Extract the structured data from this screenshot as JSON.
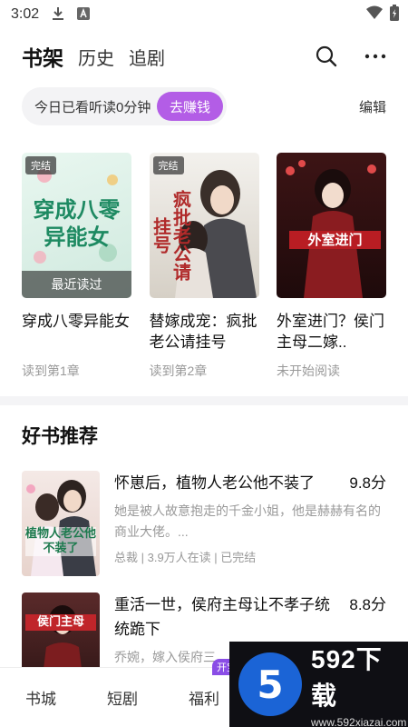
{
  "status_bar": {
    "time": "3:02",
    "icons": [
      "download-icon",
      "a-app-icon",
      "wifi-icon",
      "battery-icon"
    ]
  },
  "header": {
    "tabs": [
      {
        "label": "书架",
        "active": true
      },
      {
        "label": "历史",
        "active": false
      },
      {
        "label": "追剧",
        "active": false
      }
    ],
    "icons": [
      "search-icon",
      "more-icon"
    ]
  },
  "read_bar": {
    "text": "今日已看听读0分钟",
    "button": "去赚钱"
  },
  "edit_label": "编辑",
  "shelf": [
    {
      "title": "穿成八零异能女",
      "progress": "读到第1章",
      "badge": "完结",
      "last_read": "最近读过",
      "cover_text": "穿成八零异能女",
      "colors": [
        "#dff2ec",
        "#eaf6ef"
      ]
    },
    {
      "title": "替嫁成宠：疯批老公请挂号",
      "progress": "读到第2章",
      "badge": "完结",
      "cover_text": "疯批老公请挂号",
      "colors": [
        "#f0eeea",
        "#d9d4cc"
      ]
    },
    {
      "title": "外室进门？侯门主母二嫁..",
      "progress": "未开始阅读",
      "cover_text": "外室进门",
      "colors": [
        "#5a1d1d",
        "#2a0f10"
      ]
    }
  ],
  "section_title": "好书推荐",
  "recommendations": [
    {
      "title": "怀崽后，植物人老公他不装了",
      "score": "9.8分",
      "desc": "她是被人故意抱走的千金小姐，他是赫赫有名的商业大佬。...",
      "meta": "总裁 | 3.9万人在读 | 已完结",
      "cover_text": "植物人老公他不装了"
    },
    {
      "title": "重活一世，侯府主母让不孝子统统跪下",
      "score": "8.8分",
      "desc": "乔婉，嫁入侯府三",
      "meta": "",
      "cover_text": "侯门主母"
    }
  ],
  "bottom_nav": {
    "items": [
      "书城",
      "短剧",
      "福利"
    ],
    "badge": "开宝"
  },
  "watermark": {
    "logo": "5",
    "brand": "592下载",
    "url": "www.592xiazai.com"
  }
}
